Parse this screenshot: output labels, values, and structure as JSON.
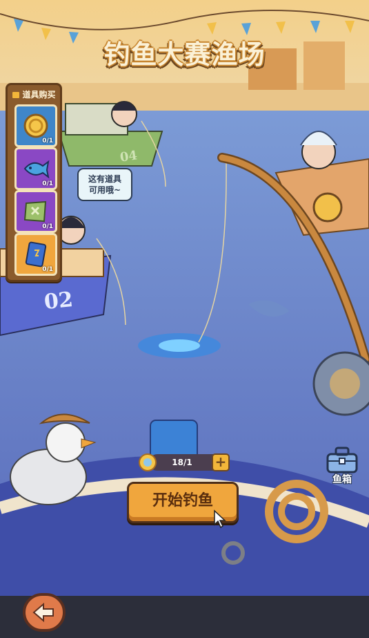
{
  "title": "钓鱼大赛渔场",
  "shop": {
    "header": "道具购买",
    "items": [
      {
        "icon": "gold-coin-icon",
        "count": "0/1",
        "color": "#3f86c9"
      },
      {
        "icon": "blue-fish-icon",
        "count": "0/1",
        "color": "#8a48c4"
      },
      {
        "icon": "treasure-map-icon",
        "count": "0/1",
        "color": "#8a48c4"
      },
      {
        "icon": "card-icon",
        "count": "0/1",
        "color": "#f0a63d"
      }
    ]
  },
  "speech_bubble": {
    "line1": "这有道具",
    "line2": "可用哦~"
  },
  "boats": {
    "left_top": "04",
    "left_bottom": "02"
  },
  "bait_counter": {
    "value": "18/1",
    "plus_label": "+"
  },
  "start_button": {
    "label": "开始钓鱼"
  },
  "fish_box": {
    "label": "鱼箱",
    "icon": "toolbox-icon"
  },
  "back_button": {
    "icon": "back-arrow-icon"
  },
  "colors": {
    "sea": "#5a74c4",
    "wood": "#8a5b2d",
    "accent": "#f0a63d"
  }
}
